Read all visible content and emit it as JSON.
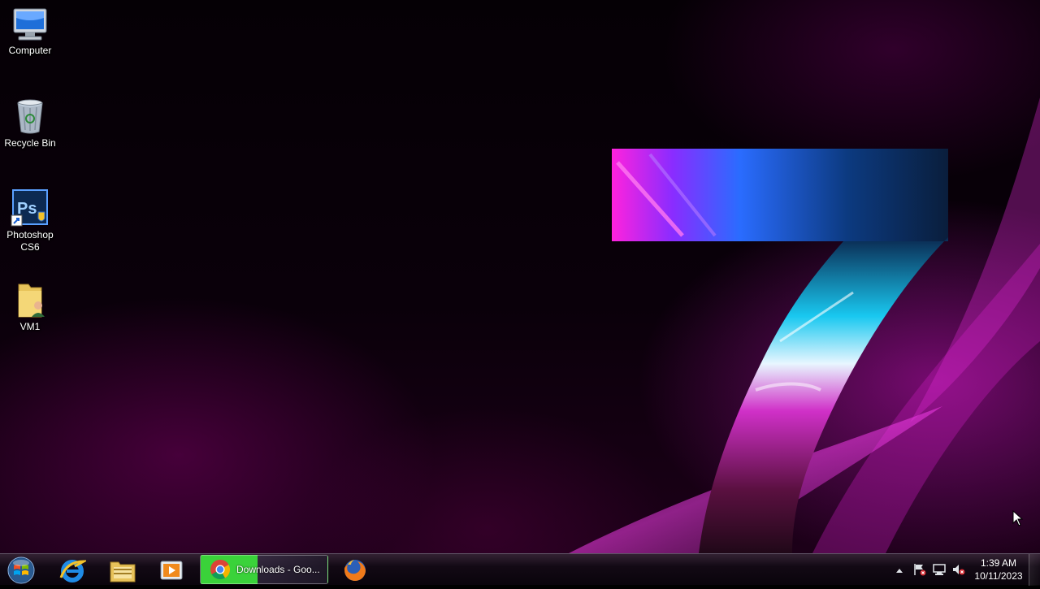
{
  "desktop": {
    "icons": [
      {
        "label": "Computer",
        "icon": "computer-icon"
      },
      {
        "label": "Recycle Bin",
        "icon": "recycle-bin-icon"
      },
      {
        "label": "Photoshop CS6",
        "icon": "photoshop-icon",
        "badge": "Ps"
      },
      {
        "label": "VM1",
        "icon": "folder-user-icon"
      }
    ]
  },
  "taskbar": {
    "start_icon": "windows-orb-icon",
    "pinned": [
      {
        "name": "internet-explorer-icon"
      },
      {
        "name": "windows-explorer-icon"
      },
      {
        "name": "media-player-icon"
      },
      {
        "name": "firefox-icon"
      }
    ],
    "active_window": {
      "title": "Downloads - Goo...",
      "icon": "chrome-icon",
      "progress": 0.45
    },
    "tray": {
      "icons": [
        "show-hidden-icons-icon",
        "action-center-flag-icon",
        "network-icon",
        "volume-muted-icon"
      ],
      "time": "1:39 AM",
      "date": "10/11/2023"
    }
  },
  "colors": {
    "accent_magenta": "#d61ad0",
    "accent_cyan": "#19c8f0",
    "download_progress_green": "#3ad23a"
  }
}
